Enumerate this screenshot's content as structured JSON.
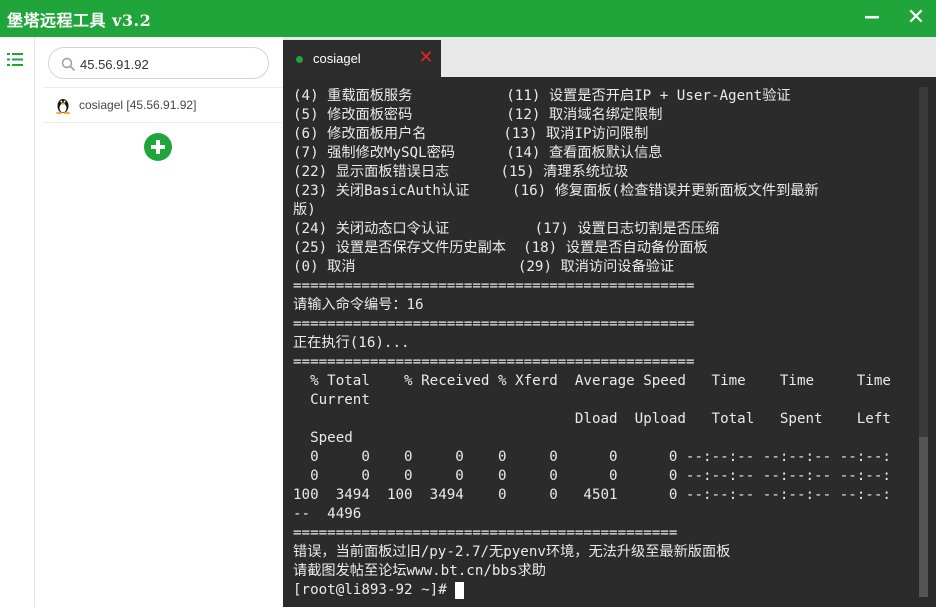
{
  "window": {
    "title": "堡塔远程工具 v3.2",
    "minimize_glyph": "−",
    "close_glyph": "✕"
  },
  "accent_color": "#20a53a",
  "iconbar": {
    "icon": "list-menu-icon"
  },
  "sidebar": {
    "search": {
      "value": "45.56.91.92",
      "placeholder": "",
      "icon": "search-icon"
    },
    "hosts": [
      {
        "label": "cosiagel [45.56.91.92]",
        "icon": "linux-penguin-icon"
      }
    ],
    "add_button_icon": "plus-circle-icon"
  },
  "tabs": [
    {
      "label": "cosiagel",
      "status_color": "#20a53a",
      "close_glyph": "✕"
    }
  ],
  "terminal": {
    "lines": [
      "(4) 重载面板服务           (11) 设置是否开启IP + User-Agent验证",
      "(5) 修改面板密码           (12) 取消域名绑定限制",
      "(6) 修改面板用户名         (13) 取消IP访问限制",
      "(7) 强制修改MySQL密码      (14) 查看面板默认信息",
      "(22) 显示面板错误日志      (15) 清理系统垃圾",
      "(23) 关闭BasicAuth认证     (16) 修复面板(检查错误并更新面板文件到最新",
      "版)",
      "(24) 关闭动态口令认证          (17) 设置日志切割是否压缩",
      "(25) 设置是否保存文件历史副本  (18) 设置是否自动备份面板",
      "(0) 取消                   (29) 取消访问设备验证",
      "===============================================",
      "请输入命令编号：16",
      "===============================================",
      "正在执行(16)...",
      "===============================================",
      "  % Total    % Received % Xferd  Average Speed   Time    Time     Time",
      "  Current",
      "                                 Dload  Upload   Total   Spent    Left",
      "  Speed",
      "  0     0    0     0    0     0      0      0 --:--:-- --:--:-- --:--:",
      "  0     0    0     0    0     0      0      0 --:--:-- --:--:-- --:--:",
      "100  3494  100  3494    0     0   4501      0 --:--:-- --:--:-- --:--:",
      "--  4496",
      "=============================================",
      "错误，当前面板过旧/py-2.7/无pyenv环境，无法升级至最新版面板",
      "请截图发帖至论坛www.bt.cn/bbs求助"
    ],
    "prompt": "[root@li893-92 ~]# "
  }
}
